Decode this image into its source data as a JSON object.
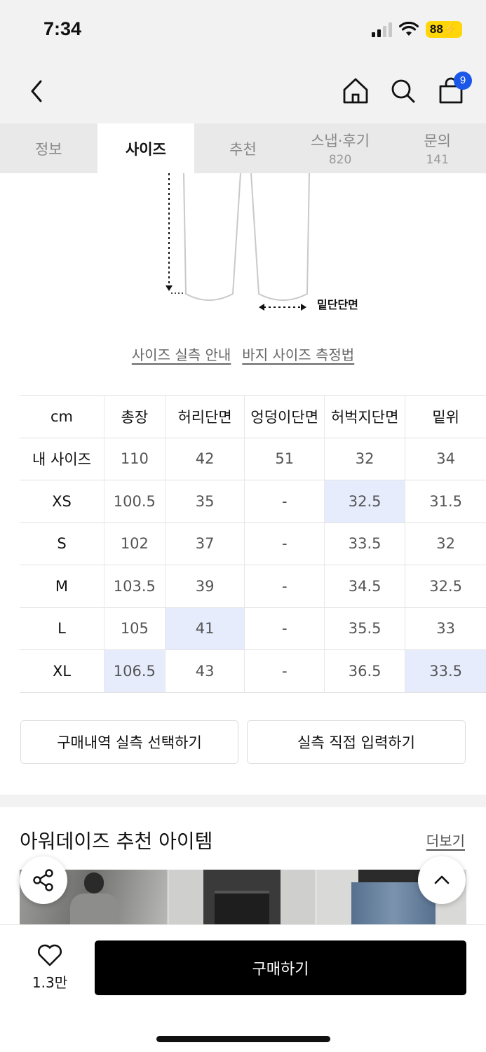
{
  "status_bar": {
    "time": "7:34",
    "battery": "88"
  },
  "header": {
    "cart_count": "9"
  },
  "tabs": [
    {
      "label": "정보",
      "sub": ""
    },
    {
      "label": "사이즈",
      "sub": ""
    },
    {
      "label": "추천",
      "sub": ""
    },
    {
      "label": "스냅·후기",
      "sub": "820"
    },
    {
      "label": "문의",
      "sub": "141"
    }
  ],
  "diagram": {
    "hem_label": "밑단단면"
  },
  "guide_links": {
    "size_guide": "사이즈 실측 안내",
    "measure_guide": "바지 사이즈 측정법"
  },
  "size_table": {
    "unit": "cm",
    "columns": [
      "총장",
      "허리단면",
      "엉덩이단면",
      "허벅지단면",
      "밑위"
    ],
    "rows": [
      {
        "label": "내 사이즈",
        "values": [
          "110",
          "42",
          "51",
          "32",
          "34"
        ]
      },
      {
        "label": "XS",
        "values": [
          "100.5",
          "35",
          "-",
          "32.5",
          "31.5"
        ]
      },
      {
        "label": "S",
        "values": [
          "102",
          "37",
          "-",
          "33.5",
          "32"
        ]
      },
      {
        "label": "M",
        "values": [
          "103.5",
          "39",
          "-",
          "34.5",
          "32.5"
        ]
      },
      {
        "label": "L",
        "values": [
          "105",
          "41",
          "-",
          "35.5",
          "33"
        ]
      },
      {
        "label": "XL",
        "values": [
          "106.5",
          "43",
          "-",
          "36.5",
          "33.5"
        ]
      }
    ],
    "highlight_color": "#e6ecfc"
  },
  "actions": {
    "purchase_history": "구매내역 실측 선택하기",
    "manual_input": "실측 직접 입력하기"
  },
  "recommend": {
    "title": "아워데이즈 추천 아이템",
    "more": "더보기"
  },
  "bottom_bar": {
    "like_count": "1.3만",
    "buy_label": "구매하기"
  },
  "colors": {
    "accent_blue": "#1a57e8",
    "battery_yellow": "#ffd60a",
    "buy_button": "#000000"
  }
}
